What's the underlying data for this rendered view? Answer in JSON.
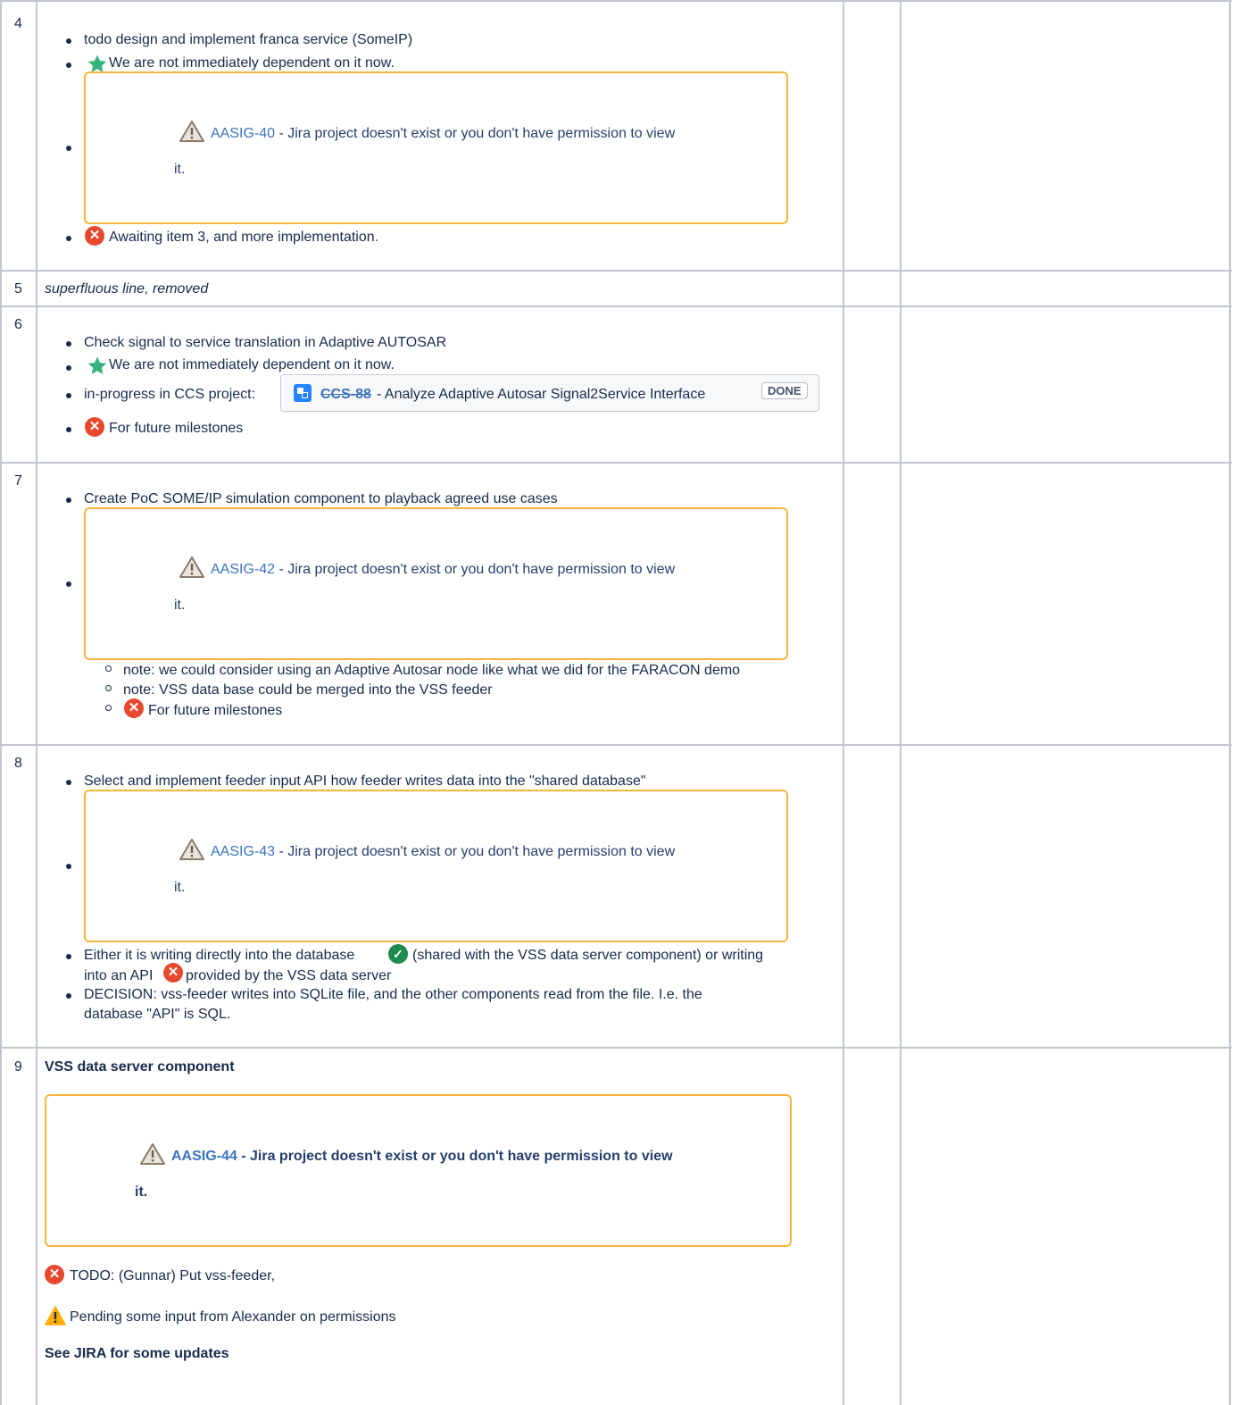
{
  "rows": {
    "r4": {
      "num": "4",
      "b1": "todo design and implement franca service (SomeIP)",
      "b2": "We are not immediately dependent on it now.",
      "jira": {
        "key": "AASIG-40",
        "msg1": " - Jira project doesn't exist or you don't have permission to view",
        "msg2": "it."
      },
      "b4": "Awaiting item 3, and more implementation."
    },
    "r5": {
      "num": "5",
      "text": "superfluous line, removed"
    },
    "r6": {
      "num": "6",
      "b1": "Check signal to service translation in Adaptive AUTOSAR",
      "b2": "We are not immediately dependent on it now.",
      "b3_prefix": "in-progress in CCS project:",
      "chip": {
        "key": "CCS-88",
        "summary": " - Analyze Adaptive Autosar Signal2Service Interface",
        "status": "DONE"
      },
      "b4": "For future milestones"
    },
    "r7": {
      "num": "7",
      "b1": "Create PoC SOME/IP simulation component to playback agreed use cases",
      "jira": {
        "key": "AASIG-42",
        "msg1": " - Jira project doesn't exist or you don't have permission to view",
        "msg2": "it."
      },
      "s1": "note: we could consider using an Adaptive Autosar node like what we did for the FARACON demo",
      "s2": "note: VSS data base could be merged into the VSS feeder",
      "s3": "For future milestones"
    },
    "r8": {
      "num": "8",
      "b1": "Select and implement feeder input API  how feeder writes data into the \"shared database\"",
      "jira": {
        "key": "AASIG-43",
        "msg1": " - Jira project doesn't exist or you don't have permission to view",
        "msg2": "it."
      },
      "b3a": "Either it is writing directly into the database",
      "b3b": "(shared with the VSS data server component) or writing",
      "b3c": "into an API",
      "b3d": "provided by the VSS data server",
      "b4a": "DECISION:  vss-feeder writes into SQLite file, and the other components read from the file.  I.e. the",
      "b4b": "database \"API\" is SQL."
    },
    "r9": {
      "num": "9",
      "title": "VSS data server component",
      "jira": {
        "key": "AASIG-44",
        "msg1": " - Jira project doesn't exist or you don't have permission to view",
        "msg2": "it."
      },
      "todo": "TODO: (Gunnar) Put vss-feeder,",
      "pending": "Pending some input from Alexander on permissions",
      "see": "See JIRA for some updates"
    }
  },
  "colors": {
    "border": "#c1c7d0",
    "jira_box": "#f6b63e",
    "link": "#3a73bf",
    "error_icon": "#e6492d",
    "ok_icon": "#1e8c4e",
    "star": "#36b37e",
    "warning": "#ffab00"
  },
  "icons": [
    "star-icon",
    "error-icon",
    "check-icon",
    "warning-icon",
    "jira-story-icon"
  ]
}
